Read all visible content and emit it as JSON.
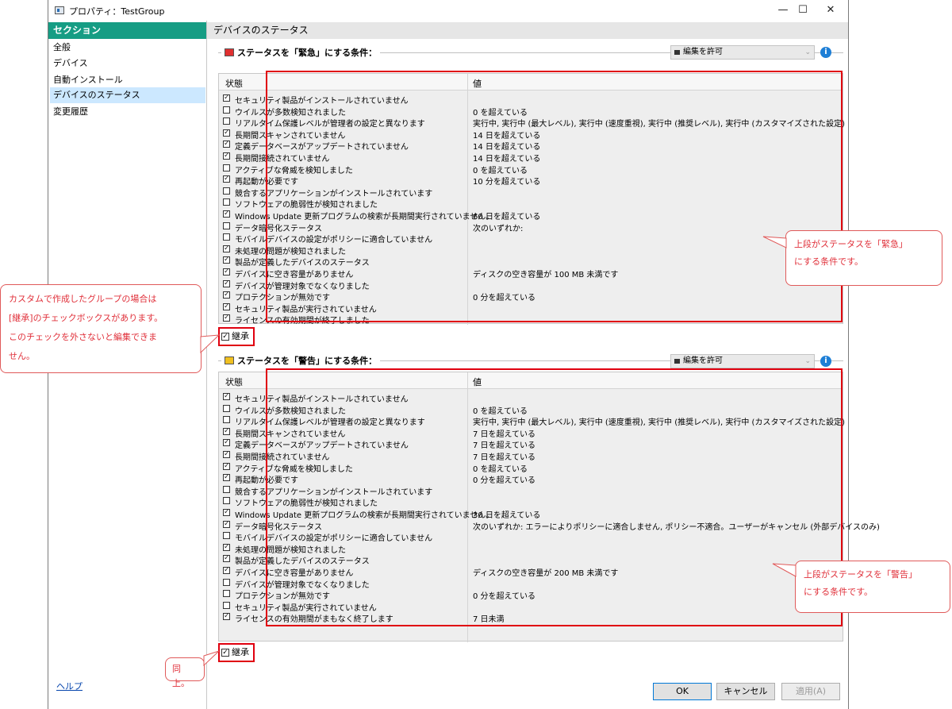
{
  "window": {
    "title": "プロパティ：TestGroup",
    "controls": {
      "minimize": "—",
      "maximize": "☐",
      "close": "✕"
    }
  },
  "sidebar": {
    "header": "セクション",
    "items": [
      {
        "label": "全般"
      },
      {
        "label": "デバイス"
      },
      {
        "label": "自動インストール"
      },
      {
        "label": "デバイスのステータス",
        "selected": true
      },
      {
        "label": "変更履歴"
      }
    ],
    "help_label": "ヘルプ"
  },
  "main": {
    "header": "デバイスのステータス",
    "critical": {
      "title": "ステータスを「緊急」にする条件：",
      "combo": "編集を許可",
      "col_state": "状態",
      "col_value": "値",
      "inherit_label": "継承",
      "inherit_checked": true,
      "rows": [
        {
          "checked": true,
          "label": "セキュリティ製品がインストールされていません",
          "value": ""
        },
        {
          "checked": false,
          "label": "ウイルスが多数検知されました",
          "value": "0 を超えている"
        },
        {
          "checked": false,
          "label": "リアルタイム保護レベルが管理者の設定と異なります",
          "value": "実行中, 実行中 (最大レベル), 実行中 (速度重視), 実行中 (推奨レベル), 実行中 (カスタマイズされた設定)"
        },
        {
          "checked": true,
          "label": "長期間スキャンされていません",
          "value": "14 日を超えている"
        },
        {
          "checked": true,
          "label": "定義データベースがアップデートされていません",
          "value": "14 日を超えている"
        },
        {
          "checked": true,
          "label": "長期間接続されていません",
          "value": "14 日を超えている"
        },
        {
          "checked": false,
          "label": "アクティブな脅威を検知しました",
          "value": "0 を超えている"
        },
        {
          "checked": true,
          "label": "再起動が必要です",
          "value": "10 分を超えている"
        },
        {
          "checked": false,
          "label": "競合するアプリケーションがインストールされています",
          "value": ""
        },
        {
          "checked": false,
          "label": "ソフトウェアの脆弱性が検知されました",
          "value": ""
        },
        {
          "checked": true,
          "label": "Windows Update 更新プログラムの検索が長期間実行されていません。",
          "value": "60 日を超えている"
        },
        {
          "checked": false,
          "label": "データ暗号化ステータス",
          "value": "次のいずれか:"
        },
        {
          "checked": false,
          "label": "モバイルデバイスの設定がポリシーに適合していません",
          "value": ""
        },
        {
          "checked": true,
          "label": "未処理の問題が検知されました",
          "value": ""
        },
        {
          "checked": true,
          "label": "製品が定義したデバイスのステータス",
          "value": ""
        },
        {
          "checked": true,
          "label": "デバイスに空き容量がありません",
          "value": "ディスクの空き容量が 100 MB 未満です"
        },
        {
          "checked": true,
          "label": "デバイスが管理対象でなくなりました",
          "value": ""
        },
        {
          "checked": true,
          "label": "プロテクションが無効です",
          "value": "0 分を超えている"
        },
        {
          "checked": true,
          "label": "セキュリティ製品が実行されていません",
          "value": ""
        },
        {
          "checked": true,
          "label": "ライセンスの有効期間が終了しました",
          "value": ""
        }
      ]
    },
    "warning": {
      "title": "ステータスを「警告」にする条件：",
      "combo": "編集を許可",
      "col_state": "状態",
      "col_value": "値",
      "inherit_label": "継承",
      "inherit_checked": true,
      "rows": [
        {
          "checked": true,
          "label": "セキュリティ製品がインストールされていません",
          "value": ""
        },
        {
          "checked": false,
          "label": "ウイルスが多数検知されました",
          "value": "0 を超えている"
        },
        {
          "checked": false,
          "label": "リアルタイム保護レベルが管理者の設定と異なります",
          "value": "実行中, 実行中 (最大レベル), 実行中 (速度重視), 実行中 (推奨レベル), 実行中 (カスタマイズされた設定)"
        },
        {
          "checked": true,
          "label": "長期間スキャンされていません",
          "value": "7 日を超えている"
        },
        {
          "checked": true,
          "label": "定義データベースがアップデートされていません",
          "value": "7 日を超えている"
        },
        {
          "checked": true,
          "label": "長期間接続されていません",
          "value": "7 日を超えている"
        },
        {
          "checked": true,
          "label": "アクティブな脅威を検知しました",
          "value": "0 を超えている"
        },
        {
          "checked": true,
          "label": "再起動が必要です",
          "value": "0 分を超えている"
        },
        {
          "checked": false,
          "label": "競合するアプリケーションがインストールされています",
          "value": ""
        },
        {
          "checked": false,
          "label": "ソフトウェアの脆弱性が検知されました",
          "value": ""
        },
        {
          "checked": true,
          "label": "Windows Update 更新プログラムの検索が長期間実行されていません。",
          "value": "30 日を超えている"
        },
        {
          "checked": true,
          "label": "データ暗号化ステータス",
          "value": "次のいずれか: エラーによりポリシーに適合しません, ポリシー不適合。ユーザーがキャンセル (外部デバイスのみ)"
        },
        {
          "checked": false,
          "label": "モバイルデバイスの設定がポリシーに適合していません",
          "value": ""
        },
        {
          "checked": true,
          "label": "未処理の問題が検知されました",
          "value": ""
        },
        {
          "checked": true,
          "label": "製品が定義したデバイスのステータス",
          "value": ""
        },
        {
          "checked": true,
          "label": "デバイスに空き容量がありません",
          "value": "ディスクの空き容量が 200 MB 未満です"
        },
        {
          "checked": false,
          "label": "デバイスが管理対象でなくなりました",
          "value": ""
        },
        {
          "checked": false,
          "label": "プロテクションが無効です",
          "value": "0 分を超えている"
        },
        {
          "checked": false,
          "label": "セキュリティ製品が実行されていません",
          "value": ""
        },
        {
          "checked": true,
          "label": "ライセンスの有効期間がまもなく終了します",
          "value": "7 日未満"
        }
      ]
    }
  },
  "buttons": {
    "ok": "OK",
    "cancel": "キャンセル",
    "apply": "適用(A)"
  },
  "annotations": {
    "critical_note": [
      "上段がステータスを「緊急」",
      "にする条件です。"
    ],
    "warning_note": [
      "上段がステータスを「警告」",
      "にする条件です。"
    ],
    "inherit_note": [
      "カスタムで作成したグループの場合は",
      "[継承]のチェックボックスがあります。",
      "このチェックを外さないと編集できま",
      "せん。"
    ],
    "same_note": "同上。"
  },
  "colors": {
    "accent": "#169d84",
    "highlight": "#e0000f",
    "selection": "#cce8ff"
  }
}
